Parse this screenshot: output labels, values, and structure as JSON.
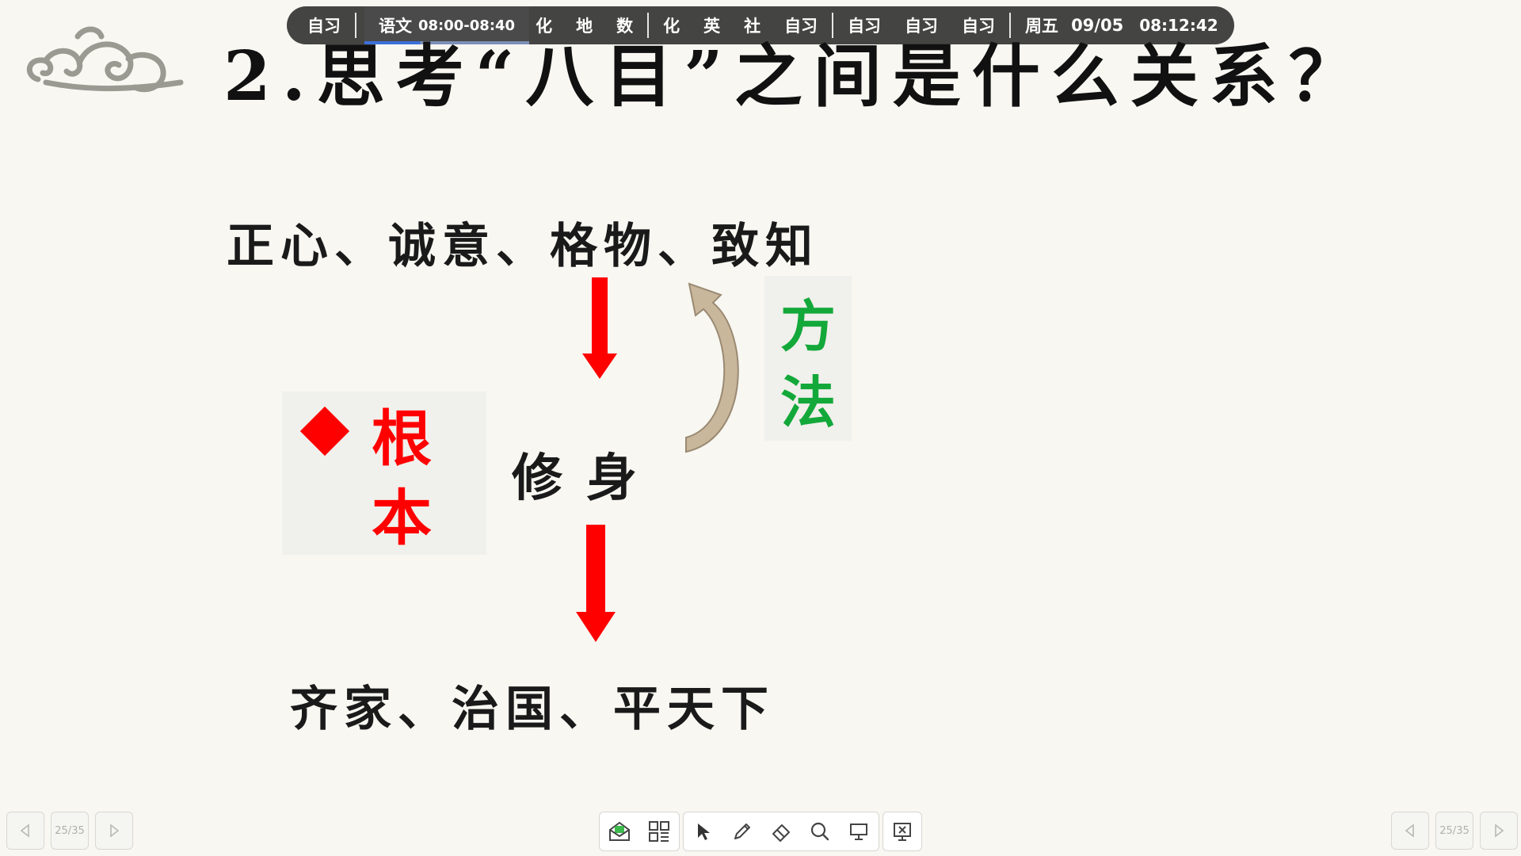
{
  "schedule_bar": {
    "items": [
      {
        "label": "自习"
      },
      {
        "label": "语文",
        "time": "08:00-08:40",
        "current": true
      },
      {
        "label": "化"
      },
      {
        "label": "地"
      },
      {
        "label": "数"
      },
      {
        "label": "化"
      },
      {
        "label": "英"
      },
      {
        "label": "社"
      },
      {
        "label": "自习"
      },
      {
        "label": "自习"
      },
      {
        "label": "自习"
      },
      {
        "label": "自习"
      }
    ],
    "day": "周五",
    "date": "09/05",
    "clock": "08:12:42"
  },
  "slide": {
    "title": "2.思考“八目”之间是什么关系？",
    "top_row": "正心、诚意、格物、致知",
    "center_word": "修身",
    "bottom_row": "齐家、治国、平天下",
    "root_label_1": "根",
    "root_label_2": "本",
    "method_label_1": "方",
    "method_label_2": "法",
    "colors": {
      "arrow": "#ff0000",
      "root_text": "#ff0000",
      "method_text": "#13a83a",
      "curved_arrow": "#c9b79c"
    }
  },
  "left_nav": {
    "prev_icon": "triangle-left-icon",
    "page": "25/35",
    "next_icon": "triangle-right-icon"
  },
  "right_nav": {
    "prev_icon": "triangle-left-icon",
    "page": "25/35",
    "next_icon": "triangle-right-icon"
  },
  "toolbar": {
    "icons": [
      "inbox-icon",
      "qr-grid-icon",
      "pointer-icon",
      "pen-icon",
      "eraser-icon",
      "search-icon",
      "whiteboard-icon",
      "close-presentation-icon"
    ]
  }
}
